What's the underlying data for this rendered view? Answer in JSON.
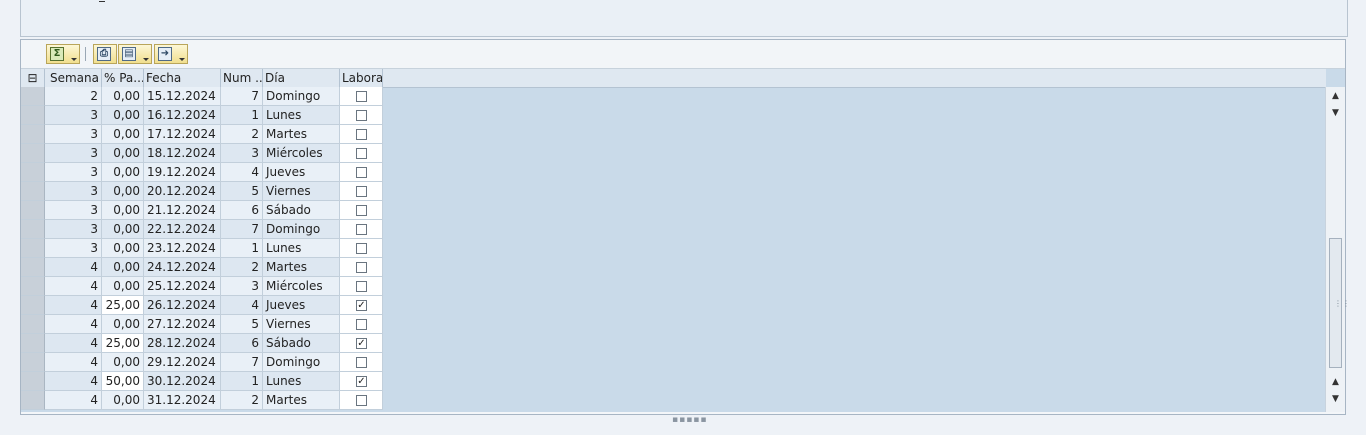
{
  "toolbar": {
    "sum_icon": "sigma-icon",
    "print_icon": "print-icon",
    "views_icon": "views-icon",
    "export_icon": "export-icon"
  },
  "grid": {
    "columns": [
      "Semana",
      "% Pa...",
      "Fecha",
      "Num ...",
      "Día",
      "Laboral"
    ],
    "rows": [
      {
        "semana": "2",
        "pct": "0,00",
        "fecha": "15.12.2024",
        "num": "7",
        "dia": "Domingo",
        "laboral": false
      },
      {
        "semana": "3",
        "pct": "0,00",
        "fecha": "16.12.2024",
        "num": "1",
        "dia": "Lunes",
        "laboral": false
      },
      {
        "semana": "3",
        "pct": "0,00",
        "fecha": "17.12.2024",
        "num": "2",
        "dia": "Martes",
        "laboral": false
      },
      {
        "semana": "3",
        "pct": "0,00",
        "fecha": "18.12.2024",
        "num": "3",
        "dia": "Miércoles",
        "laboral": false
      },
      {
        "semana": "3",
        "pct": "0,00",
        "fecha": "19.12.2024",
        "num": "4",
        "dia": "Jueves",
        "laboral": false
      },
      {
        "semana": "3",
        "pct": "0,00",
        "fecha": "20.12.2024",
        "num": "5",
        "dia": "Viernes",
        "laboral": false
      },
      {
        "semana": "3",
        "pct": "0,00",
        "fecha": "21.12.2024",
        "num": "6",
        "dia": "Sábado",
        "laboral": false
      },
      {
        "semana": "3",
        "pct": "0,00",
        "fecha": "22.12.2024",
        "num": "7",
        "dia": "Domingo",
        "laboral": false
      },
      {
        "semana": "3",
        "pct": "0,00",
        "fecha": "23.12.2024",
        "num": "1",
        "dia": "Lunes",
        "laboral": false
      },
      {
        "semana": "4",
        "pct": "0,00",
        "fecha": "24.12.2024",
        "num": "2",
        "dia": "Martes",
        "laboral": false
      },
      {
        "semana": "4",
        "pct": "0,00",
        "fecha": "25.12.2024",
        "num": "3",
        "dia": "Miércoles",
        "laboral": false
      },
      {
        "semana": "4",
        "pct": "25,00",
        "fecha": "26.12.2024",
        "num": "4",
        "dia": "Jueves",
        "laboral": true
      },
      {
        "semana": "4",
        "pct": "0,00",
        "fecha": "27.12.2024",
        "num": "5",
        "dia": "Viernes",
        "laboral": false
      },
      {
        "semana": "4",
        "pct": "25,00",
        "fecha": "28.12.2024",
        "num": "6",
        "dia": "Sábado",
        "laboral": true
      },
      {
        "semana": "4",
        "pct": "0,00",
        "fecha": "29.12.2024",
        "num": "7",
        "dia": "Domingo",
        "laboral": false
      },
      {
        "semana": "4",
        "pct": "50,00",
        "fecha": "30.12.2024",
        "num": "1",
        "dia": "Lunes",
        "laboral": true
      },
      {
        "semana": "4",
        "pct": "0,00",
        "fecha": "31.12.2024",
        "num": "2",
        "dia": "Martes",
        "laboral": false
      }
    ]
  },
  "colors": {
    "grid_bg": "#c9dae9",
    "header_bg": "#dfe8f1",
    "accent": "#f1df8e"
  }
}
